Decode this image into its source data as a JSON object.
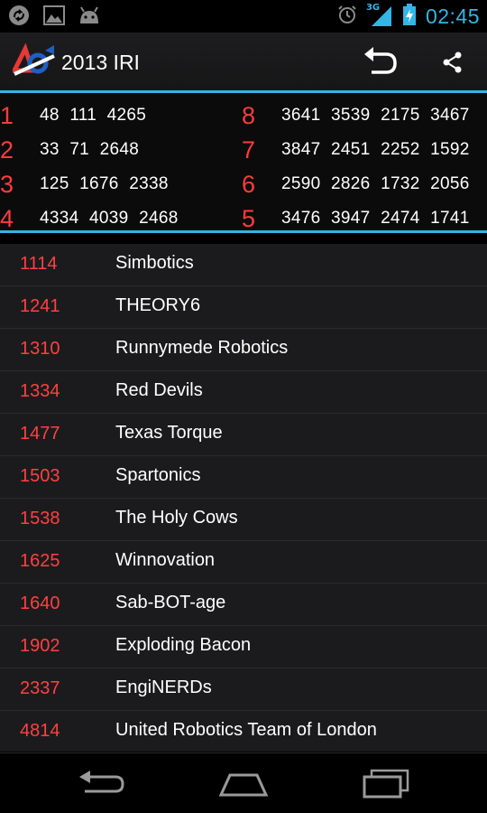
{
  "status_bar": {
    "network": "3G",
    "time": "02:45"
  },
  "action_bar": {
    "title": "2013 IRI"
  },
  "alliances": {
    "left": [
      {
        "seed": "1",
        "teams": "48  111  4265"
      },
      {
        "seed": "2",
        "teams": "33  71  2648"
      },
      {
        "seed": "3",
        "teams": "125  1676  2338"
      },
      {
        "seed": "4",
        "teams": "4334  4039  2468"
      }
    ],
    "right": [
      {
        "seed": "8",
        "teams": "3641  3539  2175  3467"
      },
      {
        "seed": "7",
        "teams": "3847  2451  2252  1592"
      },
      {
        "seed": "6",
        "teams": "2590  2826  1732  2056"
      },
      {
        "seed": "5",
        "teams": "3476  3947  2474  1741"
      }
    ]
  },
  "teams": [
    {
      "number": "1114",
      "name": "Simbotics"
    },
    {
      "number": "1241",
      "name": "THEORY6"
    },
    {
      "number": "1310",
      "name": "Runnymede Robotics"
    },
    {
      "number": "1334",
      "name": "Red Devils"
    },
    {
      "number": "1477",
      "name": "Texas Torque"
    },
    {
      "number": "1503",
      "name": "Spartonics"
    },
    {
      "number": "1538",
      "name": "The Holy Cows"
    },
    {
      "number": "1625",
      "name": "Winnovation"
    },
    {
      "number": "1640",
      "name": "Sab-BOT-age"
    },
    {
      "number": "1902",
      "name": "Exploding Bacon"
    },
    {
      "number": "2337",
      "name": "EngiNERDs"
    },
    {
      "number": "4814",
      "name": "United Robotics Team of London"
    }
  ],
  "colors": {
    "accent": "#33b5e5",
    "seed_red": "#ff3b3b",
    "team_number_red": "#ff4040"
  },
  "icons": {
    "status_left": [
      "sync-icon",
      "image-icon",
      "android-icon"
    ],
    "status_right": [
      "alarm-icon",
      "signal-3g-icon",
      "battery-charging-icon"
    ],
    "action": [
      "undo-icon",
      "share-icon"
    ],
    "nav": [
      "back-icon",
      "home-icon",
      "recent-apps-icon"
    ]
  }
}
